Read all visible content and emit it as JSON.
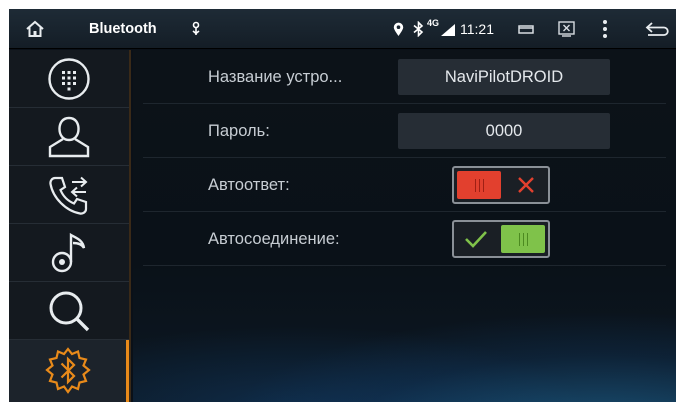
{
  "status_bar": {
    "title": "Bluetooth",
    "network_type": "4G",
    "time": "11:21",
    "icons": [
      "home-icon",
      "usb-icon",
      "location-icon",
      "bluetooth-icon",
      "signal-icon",
      "window-icon",
      "screenshot-icon",
      "more-icon",
      "back-icon"
    ]
  },
  "sidebar": {
    "items": [
      {
        "icon": "dialpad-icon",
        "active": false
      },
      {
        "icon": "contacts-icon",
        "active": false
      },
      {
        "icon": "call-log-icon",
        "active": false
      },
      {
        "icon": "music-icon",
        "active": false
      },
      {
        "icon": "search-icon",
        "active": false
      },
      {
        "icon": "bluetooth-settings-icon",
        "active": true
      }
    ],
    "active_color": "#e88a1a"
  },
  "settings": {
    "device_name": {
      "label": "Название устро...",
      "value": "NaviPilotDROID"
    },
    "password": {
      "label": "Пароль:",
      "value": "0000"
    },
    "auto_answer": {
      "label": "Автоответ:",
      "enabled": false
    },
    "auto_connect": {
      "label": "Автосоединение:",
      "enabled": true
    }
  },
  "colors": {
    "toggle_off": "#e2402e",
    "toggle_on": "#7fc24a",
    "accent": "#e88a1a"
  }
}
